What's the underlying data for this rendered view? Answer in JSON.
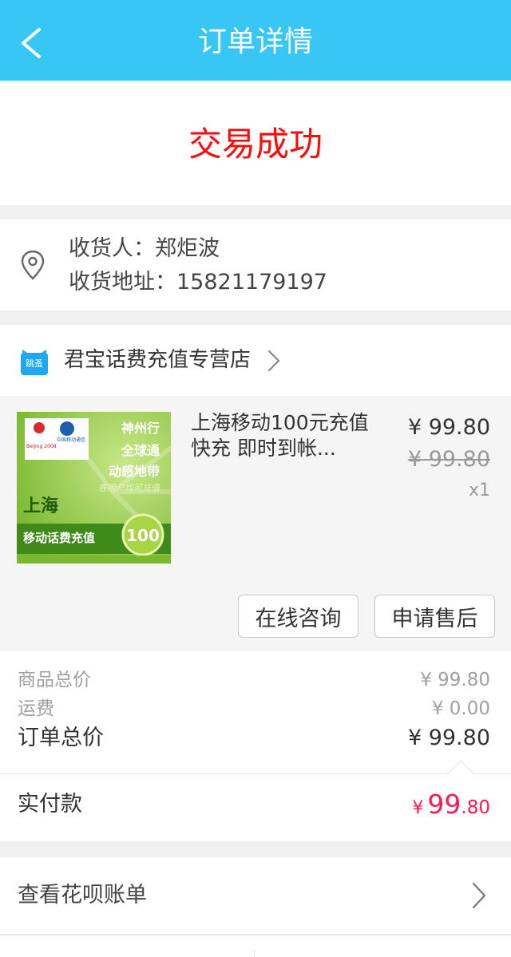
{
  "header": {
    "title": "订单详情",
    "back_icon": "chevron-left-icon"
  },
  "status": {
    "text": "交易成功",
    "color": "#ff0a0a"
  },
  "address": {
    "icon": "location-pin-icon",
    "receiver_line": "收货人：郑炬波",
    "address_line": "收货地址：15821179197"
  },
  "shop": {
    "badge_text": "跳蚤",
    "name": "君宝话费充值专营店",
    "arrow_icon": "chevron-right-icon"
  },
  "item": {
    "thumbnail": {
      "olympic_text": "Beijing 2008",
      "carrier_text": "中国移动通信",
      "slogan_1": "神州行",
      "slogan_2": "全球通",
      "slogan_3": "动感地带",
      "slogan_4": "各用户均可充值",
      "region": "上海",
      "product": "移动话费充值",
      "amount": "100"
    },
    "title": "上海移动100元充值 快充 即时到帐...",
    "price_now": "¥ 99.80",
    "price_old": "¥ 99.80",
    "quantity": "x1",
    "buttons": {
      "consult": "在线咨询",
      "after_sale": "申请售后"
    }
  },
  "summary": {
    "goods_total_label": "商品总价",
    "goods_total_value": "¥ 99.80",
    "shipping_label": "运费",
    "shipping_value": "¥ 0.00",
    "order_total_label": "订单总价",
    "order_total_value": "¥ 99.80",
    "paid_label": "实付款",
    "paid_symbol": "¥",
    "paid_int": "99",
    "paid_dec": ".80",
    "paid_color": "#ff1950"
  },
  "bill": {
    "label": "查看花呗账单",
    "arrow_icon": "chevron-right-icon"
  },
  "colors": {
    "header_bg": "#38c6f5",
    "thumb_green": "#8cc63f"
  }
}
